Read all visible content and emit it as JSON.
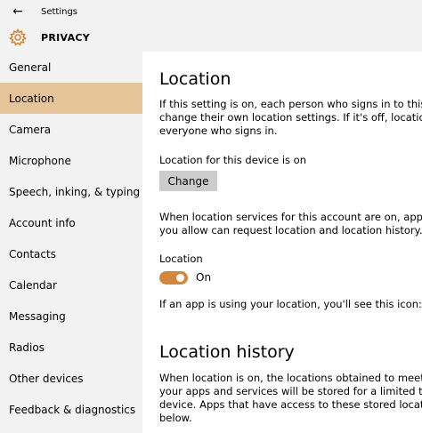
{
  "window": {
    "back_label": "←",
    "title": "Settings"
  },
  "header": {
    "title": "PRIVACY",
    "icon": "gear-icon",
    "accent": "#d3873a"
  },
  "sidebar": {
    "active_color": "#e6c49a",
    "items": [
      {
        "label": "General"
      },
      {
        "label": "Location"
      },
      {
        "label": "Camera"
      },
      {
        "label": "Microphone"
      },
      {
        "label": "Speech, inking, & typing"
      },
      {
        "label": "Account info"
      },
      {
        "label": "Contacts"
      },
      {
        "label": "Calendar"
      },
      {
        "label": "Messaging"
      },
      {
        "label": "Radios"
      },
      {
        "label": "Other devices"
      },
      {
        "label": "Feedback & diagnostics"
      }
    ],
    "selected": "Location"
  },
  "main": {
    "heading": "Location",
    "intro": [
      "If this setting is on, each person who signs in to this device ca",
      "change their own location settings. If it's off, location is off fo",
      "everyone who signs in."
    ],
    "device_status": "Location for this device is on",
    "change_label": "Change",
    "services_text": [
      "When location services for this account are on, apps and servi",
      "you allow can request location and location history."
    ],
    "toggle_label": "Location",
    "toggle_state": "On",
    "icon_note": "If an app is using your location, you'll see this icon:",
    "history_heading": "Location history",
    "history_text": [
      "When location is on, the locations obtained to meet the need",
      "your apps and services will be stored for a limited time on the",
      "device. Apps that have access to these stored locations will a",
      "below."
    ]
  }
}
